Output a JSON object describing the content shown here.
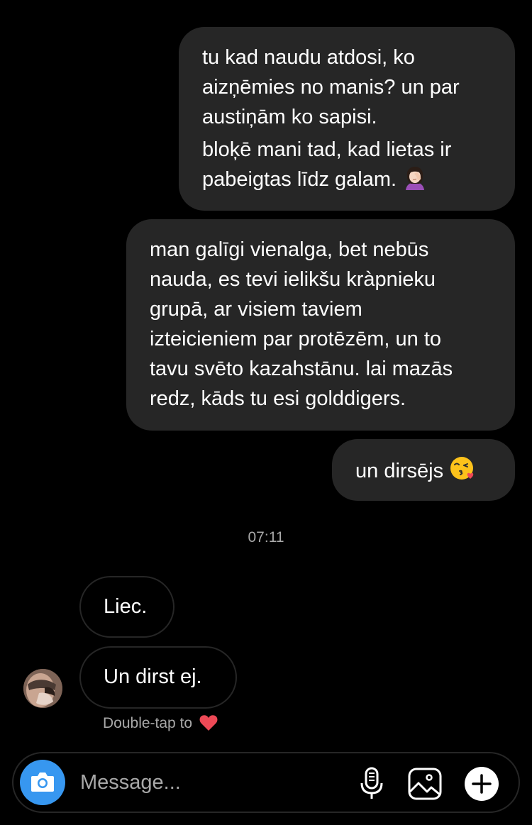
{
  "thread": {
    "outgoing": [
      {
        "lines": [
          "tu kad naudu atdosi, ko",
          "aizņēmies no manis? un par",
          "austiņām ko sapisi.",
          "bloķē mani tad, kad lietas ir",
          "pabeigtas līdz galam."
        ],
        "emoji": "face-palm-woman-icon"
      },
      {
        "lines": [
          "man galīgi vienalga, bet nebūs",
          "nauda, es tevi ielikšu kràpnieku",
          "grupā, ar visiem taviem",
          "izteicieniem par protēzēm, un to",
          "tavu svēto kazahstānu. lai mazās",
          "redz, kāds tu esi golddigers."
        ]
      },
      {
        "lines": [
          "un dirsējs"
        ],
        "emoji": "kissing-heart-face-icon"
      }
    ],
    "timestamp": "07:11",
    "incoming": [
      {
        "text": "Liec."
      },
      {
        "text": "Un dirst ej."
      }
    ],
    "reaction_hint": "Double-tap to",
    "reaction_icon": "red-heart-icon"
  },
  "composer": {
    "placeholder": "Message...",
    "camera_icon": "camera-icon",
    "mic_icon": "microphone-icon",
    "gallery_icon": "image-gallery-icon",
    "add_icon": "plus-circle-icon"
  },
  "colors": {
    "background": "#000000",
    "outgoing_bubble": "#262626",
    "secondary_text": "#a8a8a8",
    "accent": "#3797f0",
    "heart": "#ed4956"
  }
}
